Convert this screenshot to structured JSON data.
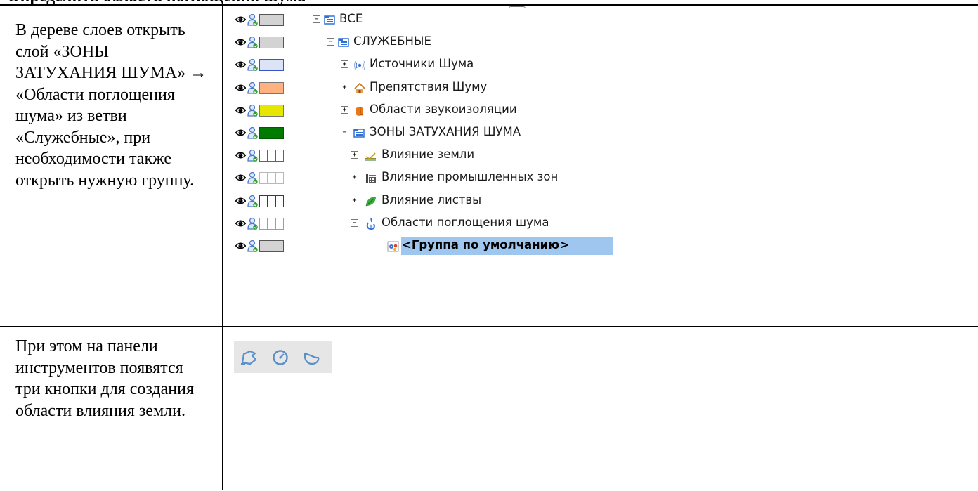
{
  "heading_cropped": "Определить область поглощения шума",
  "rows": [
    {
      "text": "В дереве слоев открыть слой «ЗОНЫ ЗАТУХАНИЯ ШУМА» → «Области поглощения шума» из ветви «Служебные», при необходимости также открыть нужную группу."
    },
    {
      "text": "При этом на панели инструментов появятся три кнопки для создания области влияния земли."
    }
  ],
  "tree": {
    "nodes": [
      {
        "label": "ВСЕ",
        "icon": "folder-layer-icon",
        "swatch": "#d3d3d3",
        "swatch_border": "#555555",
        "swatch_style": "solid",
        "expander": "⊟"
      },
      {
        "label": "СЛУЖЕБНЫЕ",
        "icon": "folder-layer-icon",
        "swatch": "#d3d3d3",
        "swatch_border": "#555555",
        "swatch_style": "solid",
        "expander": "⊟"
      },
      {
        "label": "Источники Шума",
        "icon": "noise-source-icon",
        "swatch": "#dde3f7",
        "swatch_border": "#3a55c8",
        "swatch_style": "solid",
        "expander": "⊞"
      },
      {
        "label": "Препятствия Шуму",
        "icon": "house-icon",
        "swatch": "#ffb27f",
        "swatch_border": "#777777",
        "swatch_style": "solid",
        "expander": "⊞"
      },
      {
        "label": "Области звукоизоляции",
        "icon": "orange-block-icon",
        "swatch": "#e6e600",
        "swatch_border": "#777777",
        "swatch_style": "solid",
        "expander": "⊞"
      },
      {
        "label": "ЗОНЫ ЗАТУХАНИЯ ШУМА",
        "icon": "folder-layer-icon",
        "swatch": "#007a00",
        "swatch_border": "#005a00",
        "swatch_style": "solid",
        "expander": "⊟"
      },
      {
        "label": "Влияние земли",
        "icon": "ground-icon",
        "swatch": "#ffffff",
        "swatch_border": "#2a8a2a",
        "swatch_style": "columns",
        "expander": "⊞"
      },
      {
        "label": "Влияние промышленных зон",
        "icon": "factory-icon",
        "swatch": "#ffffff",
        "swatch_border": "#b8b8b8",
        "swatch_style": "columns",
        "expander": "⊞"
      },
      {
        "label": "Влияние листвы",
        "icon": "leaf-icon",
        "swatch": "#ffffff",
        "swatch_border": "#006400",
        "swatch_style": "columns",
        "expander": "⊞"
      },
      {
        "label": "Области поглощения шума",
        "icon": "absorption-icon",
        "swatch": "#ffffff",
        "swatch_border": "#6aa8ef",
        "swatch_style": "columns",
        "expander": "⊟"
      },
      {
        "label": "<Группа по умолчанию>",
        "icon": "group-icon",
        "swatch": "#d3d3d3",
        "swatch_border": "#555555",
        "swatch_style": "solid",
        "expander": ""
      }
    ]
  },
  "toolbar": {
    "buttons": [
      {
        "name": "polygon-area-icon"
      },
      {
        "name": "circle-area-icon"
      },
      {
        "name": "outline-area-icon"
      }
    ]
  }
}
